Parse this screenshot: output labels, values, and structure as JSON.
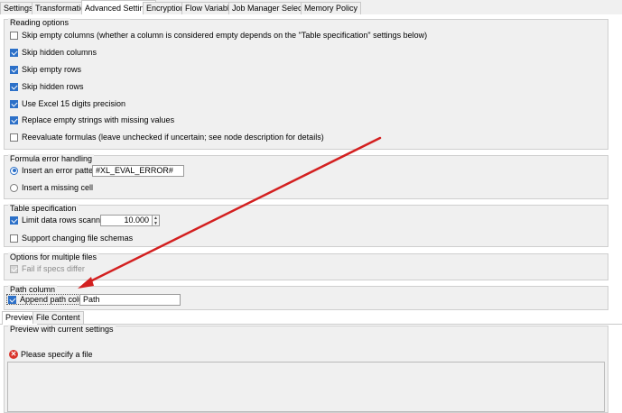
{
  "tabs": [
    {
      "label": "Settings",
      "active": false
    },
    {
      "label": "Transformation",
      "active": false
    },
    {
      "label": "Advanced Settings",
      "active": true
    },
    {
      "label": "Encryption",
      "active": false
    },
    {
      "label": "Flow Variables",
      "active": false
    },
    {
      "label": "Job Manager Selection",
      "active": false
    },
    {
      "label": "Memory Policy",
      "active": false
    }
  ],
  "reading": {
    "title": "Reading options",
    "items": [
      {
        "label": "Skip empty columns (whether a column is considered empty depends on the \"Table specification\" settings below)",
        "checked": false
      },
      {
        "label": "Skip hidden columns",
        "checked": true
      },
      {
        "label": "Skip empty rows",
        "checked": true
      },
      {
        "label": "Skip hidden rows",
        "checked": true
      },
      {
        "label": "Use Excel 15 digits precision",
        "checked": true
      },
      {
        "label": "Replace empty strings with missing values",
        "checked": true
      },
      {
        "label": "Reevaluate formulas (leave unchecked if uncertain; see node description for details)",
        "checked": false
      }
    ]
  },
  "formula": {
    "title": "Formula error handling",
    "insert_error_label": "Insert an error pattern",
    "error_pattern_value": "#XL_EVAL_ERROR#",
    "insert_missing_label": "Insert a missing cell",
    "selected": "insert_error"
  },
  "table_spec": {
    "title": "Table specification",
    "limit_label": "Limit data rows scanned",
    "limit_checked": true,
    "limit_value": "10.000",
    "support_label": "Support changing file schemas",
    "support_checked": false
  },
  "multiple": {
    "title": "Options for multiple files",
    "fail_label": "Fail if specs differ",
    "fail_checked": true,
    "fail_disabled": true
  },
  "path_col": {
    "title": "Path column",
    "append_label": "Append path column",
    "append_checked": true,
    "path_value": "Path"
  },
  "preview_tabs": [
    {
      "label": "Preview",
      "active": true
    },
    {
      "label": "File Content",
      "active": false
    }
  ],
  "preview": {
    "title": "Preview with current settings",
    "error_text": "Please specify a file"
  },
  "colors": {
    "accent": "#2c70c8",
    "arrow": "#d32020",
    "error": "#d9342b"
  }
}
